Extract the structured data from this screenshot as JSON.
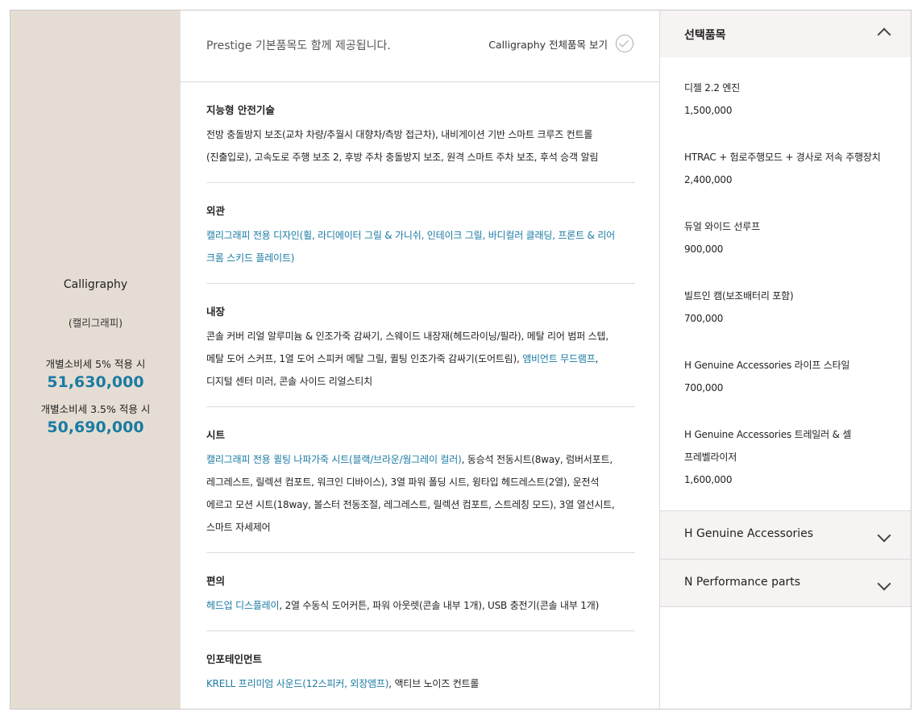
{
  "trim": {
    "name": "Calligraphy",
    "sub": "(캘리그래피)",
    "tax5_label": "개별소비세 5% 적용 시",
    "tax5_price": "51,630,000",
    "tax35_label": "개별소비세 3.5% 적용 시",
    "tax35_price": "50,690,000"
  },
  "header": {
    "text": "Prestige 기본품목도 함께 제공됩니다.",
    "link": "Calligraphy 전체품목 보기",
    "link_icon": "check-circle-icon"
  },
  "sections": [
    {
      "title": "지능형 안전기술",
      "lines": [
        [
          {
            "t": "전방 충돌방지 보조(교차 차량/추월시 대향차/측방 접근차), 내비게이션 기반 스마트 크루즈 컨트롤",
            "hl": false
          }
        ],
        [
          {
            "t": "(진출입로), 고속도로 주행 보조 2, 후방 주차 충돌방지 보조, 원격 스마트 주차 보조, 후석 승객 알림",
            "hl": false
          }
        ]
      ]
    },
    {
      "title": "외관",
      "lines": [
        [
          {
            "t": "캘리그래피 전용 디자인(휠, 라디에이터 그릴 & 가니쉬, 인테이크 그릴, 바디컬러 클래딩, 프론트 & 리어",
            "hl": true
          }
        ],
        [
          {
            "t": "크롬 스키드 플레이트)",
            "hl": true
          }
        ]
      ]
    },
    {
      "title": "내장",
      "lines": [
        [
          {
            "t": "콘솔 커버 리얼 알루미늄 & 인조가죽 감싸기, 스웨이드 내장재(헤드라이닝/필라), 메탈 리어 범퍼 스텝,",
            "hl": false
          }
        ],
        [
          {
            "t": "메탈 도어 스커프, 1열 도어 스피커 메탈 그릴, 퀼팅 인조가죽 감싸기(도어트림), ",
            "hl": false
          },
          {
            "t": "앰비언트 무드램프",
            "hl": true
          },
          {
            "t": ",",
            "hl": false
          }
        ],
        [
          {
            "t": "디지털 센터 미러, 콘솔 사이드 리얼스티치",
            "hl": false
          }
        ]
      ]
    },
    {
      "title": "시트",
      "lines": [
        [
          {
            "t": "캘리그래피 전용 퀼팅 나파가죽 시트(블랙/브라운/웜그레이 컬러)",
            "hl": true
          },
          {
            "t": ", 동승석 전동시트(8way, 럼버서포트,",
            "hl": false
          }
        ],
        [
          {
            "t": "레그레스트, 릴렉션 컴포트, 워크인 디바이스), 3열 파워 폴딩 시트, 윙타입 헤드레스트(2열), 운전석",
            "hl": false
          }
        ],
        [
          {
            "t": "에르고 모션 시트(18way, 볼스터 전동조절, 레그레스트, 릴렉션 컴포트, 스트레칭 모드), 3열 열선시트,",
            "hl": false
          }
        ],
        [
          {
            "t": "스마트 자세제어",
            "hl": false
          }
        ]
      ]
    },
    {
      "title": "편의",
      "lines": [
        [
          {
            "t": "헤드업 디스플레이",
            "hl": true
          },
          {
            "t": ", 2열 수동식 도어커튼, 파워 아웃렛(콘솔 내부 1개), USB 충전기(콘솔 내부 1개)",
            "hl": false
          }
        ]
      ]
    },
    {
      "title": "인포테인먼트",
      "lines": [
        [
          {
            "t": "KRELL 프리미엄 사운드(12스피커, 외장앰프)",
            "hl": true
          },
          {
            "t": ", 액티브 노이즈 컨트롤",
            "hl": false
          }
        ]
      ]
    }
  ],
  "options": {
    "title": "선택품목",
    "expanded_icon": "chevron-up-icon",
    "items": [
      {
        "name": "디젤 2.2 엔진",
        "price": "1,500,000"
      },
      {
        "name": "HTRAC + 험로주행모드 + 경사로 저속 주행장치",
        "price": "2,400,000"
      },
      {
        "name": "듀얼 와이드 선루프",
        "price": "900,000"
      },
      {
        "name": "빌트인 캠(보조배터리 포함)",
        "price": "700,000"
      },
      {
        "name": "H Genuine Accessories 라이프 스타일",
        "price": "700,000"
      },
      {
        "name": "H Genuine Accessories 트레일러 & 셀프레벨라이저",
        "price": "1,600,000"
      }
    ]
  },
  "accordions": [
    {
      "title": "H Genuine Accessories",
      "icon": "chevron-down-icon"
    },
    {
      "title": "N Performance parts",
      "icon": "chevron-down-icon"
    }
  ],
  "colors": {
    "trim_bg": "#e5ddd3",
    "accent": "#1b7ba3",
    "accordion_bg": "#f6f3f2"
  }
}
